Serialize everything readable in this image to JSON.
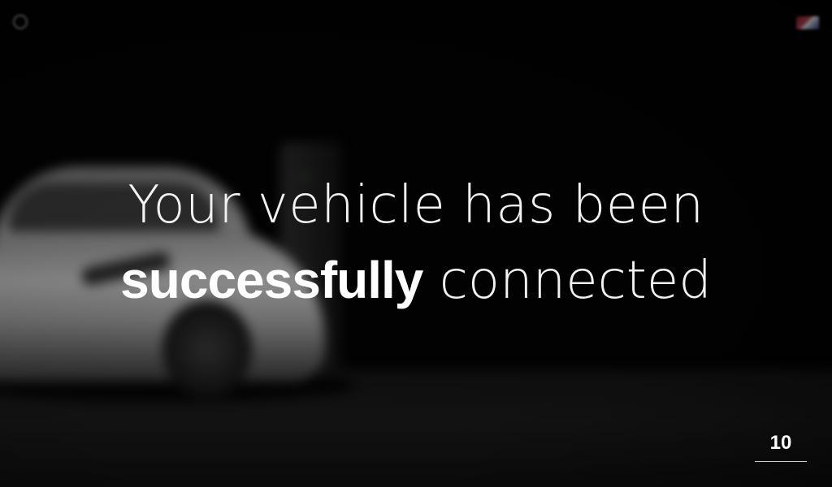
{
  "headline": {
    "line1": "Your vehicle has been",
    "line2_bold": "successfully",
    "line2_light": "connected"
  },
  "page": {
    "number": "10"
  },
  "colors": {
    "background": "#000000",
    "headline_text": "#f2f2f2"
  }
}
